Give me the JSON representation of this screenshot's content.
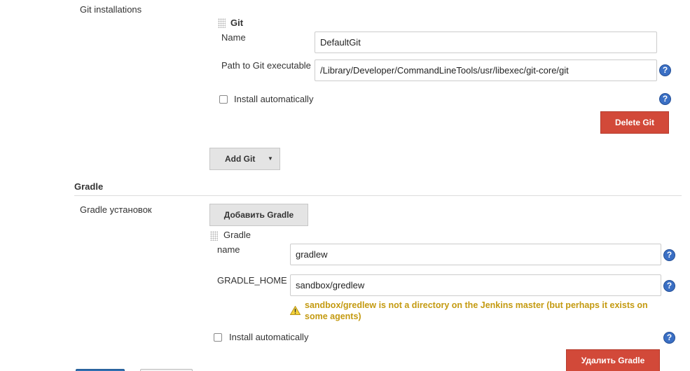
{
  "git": {
    "section_label": "Git installations",
    "installation_title": "Git",
    "name_label": "Name",
    "name_value": "DefaultGit",
    "path_label": "Path to Git executable",
    "path_value": "/Library/Developer/CommandLineTools/usr/libexec/git-core/git",
    "install_auto_label": "Install automatically",
    "delete_button": "Delete Git",
    "add_button": "Add Git"
  },
  "gradle": {
    "section_title": "Gradle",
    "installations_label": "Gradle установок",
    "add_button": "Добавить Gradle",
    "installation_title": "Gradle",
    "name_label": "name",
    "name_value": "gradlew",
    "home_label": "GRADLE_HOME",
    "home_value": "sandbox/gredlew",
    "warning": "sandbox/gredlew is not a directory on the Jenkins master (but perhaps it exists on some agents)",
    "install_auto_label": "Install automatically",
    "delete_button": "Удалить Gradle"
  },
  "help_glyph": "?",
  "dropdown_arrow": "▼",
  "warning_glyph": "!",
  "colors": {
    "help_blue": "#3a6fc4",
    "delete_red": "#d24939",
    "warning_yellow": "#c49a10",
    "save_blue": "#2f6fb0"
  }
}
